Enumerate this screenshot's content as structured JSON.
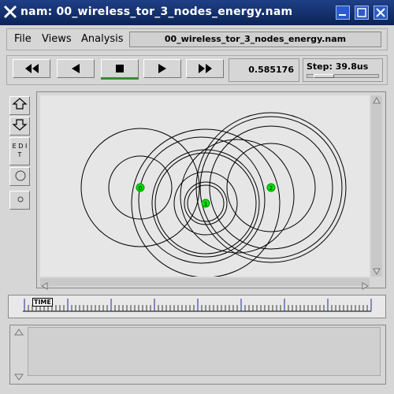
{
  "window": {
    "title": "nam: 00_wireless_tor_3_nodes_energy.nam",
    "titlebar_color": "#0b2457"
  },
  "menubar": {
    "file": "File",
    "views": "Views",
    "analysis": "Analysis",
    "filename": "00_wireless_tor_3_nodes_energy.nam"
  },
  "controls": {
    "buttons": [
      "rewind",
      "play-back",
      "stop",
      "play-forward",
      "fast-forward"
    ],
    "active_button": "stop",
    "time": "0.585176",
    "step_label": "Step: 39.8us",
    "step_slider_fraction": 0.12
  },
  "tools": {
    "edit_label": "E D I T"
  },
  "simulation": {
    "nodes": [
      {
        "id": "0",
        "label": "0"
      },
      {
        "id": "1",
        "label": "1"
      },
      {
        "id": "2",
        "label": "2"
      }
    ],
    "node_color": "#00e000"
  },
  "timeline": {
    "label": "TIME"
  }
}
